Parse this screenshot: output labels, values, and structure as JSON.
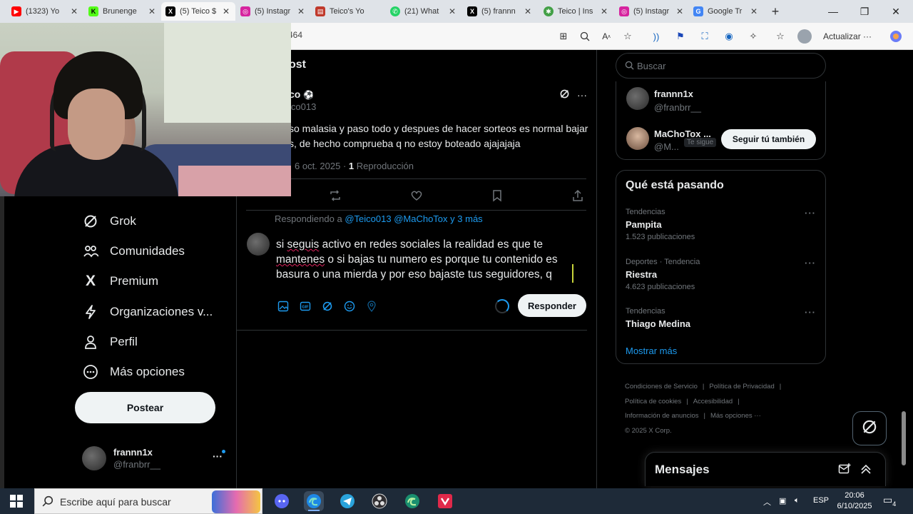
{
  "browser": {
    "tabs": [
      {
        "title": "(1323) Yo",
        "favicon": "youtube-icon",
        "color": "#ff0000"
      },
      {
        "title": "Brunenge",
        "favicon": "kick-icon",
        "color": "#53fc18"
      },
      {
        "title": "(5) Teico $",
        "favicon": "x-icon",
        "color": "#000000",
        "active": true
      },
      {
        "title": "(5) Instagr",
        "favicon": "instagram-icon",
        "color": "#d6249f"
      },
      {
        "title": "Teico's Yo",
        "favicon": "analytics-icon",
        "color": "#c0392b"
      },
      {
        "title": "(21) What",
        "favicon": "whatsapp-icon",
        "color": "#25d366"
      },
      {
        "title": "(5) frannn",
        "favicon": "x-icon",
        "color": "#000000"
      },
      {
        "title": "Teico | Ins",
        "favicon": "linktree-icon",
        "color": "#43a047"
      },
      {
        "title": "(5) Instagr",
        "favicon": "instagram-icon",
        "color": "#d6249f"
      },
      {
        "title": "Google Tr",
        "favicon": "google-translate-icon",
        "color": "#4285f4"
      }
    ],
    "url_fragment": "464",
    "update_label": "Actualizar"
  },
  "nav": {
    "items": [
      {
        "label": "Grok",
        "icon": "grok-icon"
      },
      {
        "label": "Comunidades",
        "icon": "communities-icon"
      },
      {
        "label": "Premium",
        "icon": "x-logo-icon"
      },
      {
        "label": "Organizaciones v...",
        "icon": "lightning-icon"
      },
      {
        "label": "Perfil",
        "icon": "person-icon"
      },
      {
        "label": "Más opciones",
        "icon": "more-circle-icon"
      }
    ],
    "post_button": "Postear",
    "account": {
      "name": "frannn1x",
      "handle": "@franbrr__",
      "more": "···"
    }
  },
  "post": {
    "column_title": "ost",
    "author_name": "co",
    "author_handle": "ico013",
    "text": "so malasia y paso todo y despues de hacer sorteos es normal bajar s, de hecho comprueba q no estoy boteado ajajajaja",
    "date": "6 oct. 2025",
    "views_count": "1",
    "views_label": "Reproducción"
  },
  "reply": {
    "replying_prefix": "Respondiendo a",
    "mention_1": "@Teico013",
    "mention_2": "@MaChoTox",
    "mention_more": "y 3 más",
    "text_before": "si ",
    "text_sp1": "seguis",
    "text_mid1": " activo en redes sociales la realidad es que  te ",
    "text_sp2": "mantenes",
    "text_after": " o si bajas tu numero es porque tu contenido es basura o una mierda y por eso bajaste tus seguidores, q",
    "submit_label": "Responder"
  },
  "sidebar": {
    "search_placeholder": "Buscar",
    "who": [
      {
        "name": "frannn1x",
        "handle": "@franbrr__"
      },
      {
        "name": "MaChoTox ...",
        "handle": "@M...",
        "badge": "Te sigue",
        "button": "Seguir tú también"
      }
    ],
    "trends_title": "Qué está pasando",
    "trends": [
      {
        "category": "Tendencias",
        "name": "Pampita",
        "count": "1.523 publicaciones"
      },
      {
        "category": "Deportes · Tendencia",
        "name": "Riestra",
        "count": "4.623 publicaciones"
      },
      {
        "category": "Tendencias",
        "name": "Thiago Medina",
        "count": ""
      }
    ],
    "trend_more": "···",
    "show_more": "Mostrar más",
    "footer": {
      "terms": "Condiciones de Servicio",
      "privacy": "Política de Privacidad",
      "cookies": "Política de cookies",
      "accessibility": "Accesibilidad",
      "ads": "Información de anuncios",
      "more": "Más opciones ···",
      "copyright": "© 2025 X Corp."
    },
    "messages_title": "Mensajes"
  },
  "taskbar": {
    "search_placeholder": "Escribe aquí para buscar",
    "language": "ESP",
    "time": "20:06",
    "date": "6/10/2025",
    "notification_count": "4"
  },
  "colors": {
    "accent": "#1d9bf0",
    "text": "#e7e9ea",
    "muted": "#71767b",
    "border": "#2f3336"
  }
}
